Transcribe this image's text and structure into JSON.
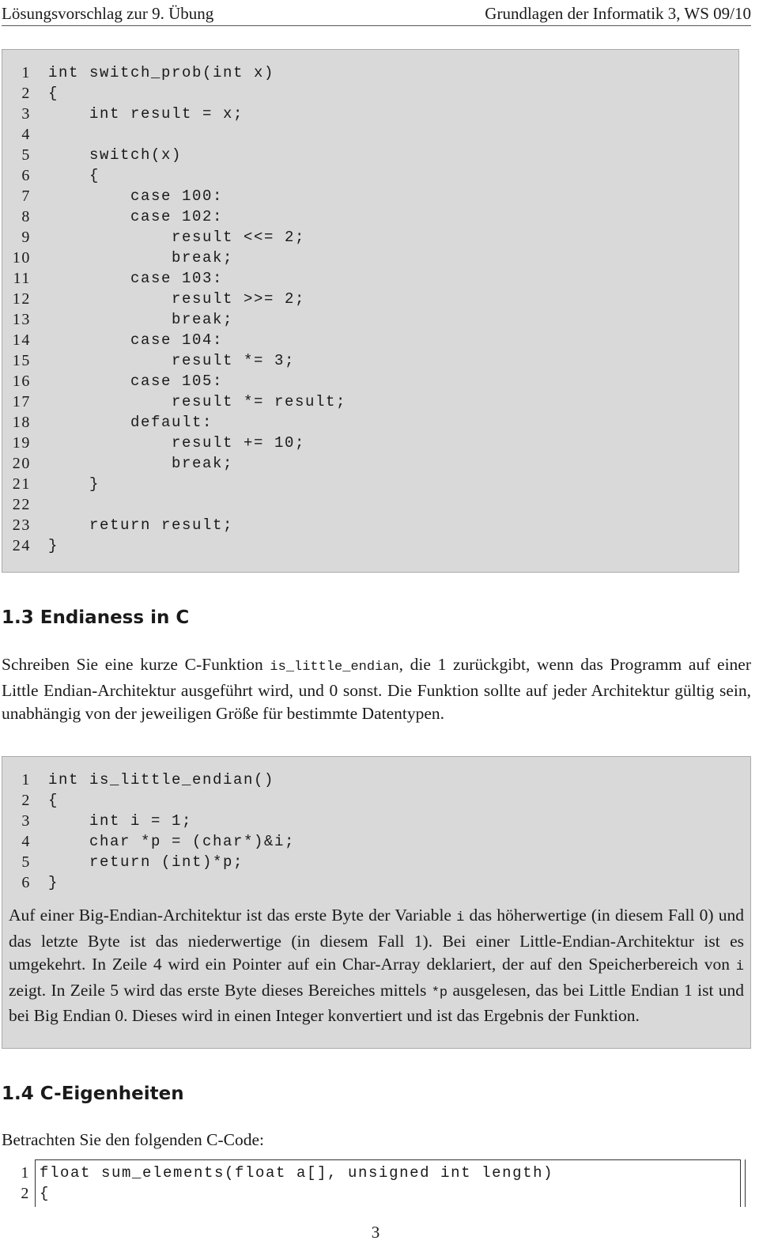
{
  "header": {
    "left": "Lösungsvorschlag zur 9. Übung",
    "right": "Grundlagen der Informatik 3, WS 09/10"
  },
  "code1": [
    {
      "n": "1",
      "t": "int switch_prob(int x)"
    },
    {
      "n": "2",
      "t": "{"
    },
    {
      "n": "3",
      "t": "    int result = x;"
    },
    {
      "n": "4",
      "t": ""
    },
    {
      "n": "5",
      "t": "    switch(x)"
    },
    {
      "n": "6",
      "t": "    {"
    },
    {
      "n": "7",
      "t": "        case 100:"
    },
    {
      "n": "8",
      "t": "        case 102:"
    },
    {
      "n": "9",
      "t": "            result <<= 2;"
    },
    {
      "n": "10",
      "t": "            break;"
    },
    {
      "n": "11",
      "t": "        case 103:"
    },
    {
      "n": "12",
      "t": "            result >>= 2;"
    },
    {
      "n": "13",
      "t": "            break;"
    },
    {
      "n": "14",
      "t": "        case 104:"
    },
    {
      "n": "15",
      "t": "            result *= 3;"
    },
    {
      "n": "16",
      "t": "        case 105:"
    },
    {
      "n": "17",
      "t": "            result *= result;"
    },
    {
      "n": "18",
      "t": "        default:"
    },
    {
      "n": "19",
      "t": "            result += 10;"
    },
    {
      "n": "20",
      "t": "            break;"
    },
    {
      "n": "21",
      "t": "    }"
    },
    {
      "n": "22",
      "t": ""
    },
    {
      "n": "23",
      "t": "    return result;"
    },
    {
      "n": "24",
      "t": "}"
    }
  ],
  "section13": {
    "title": "1.3  Endianess in C",
    "para_a": "Schreiben Sie eine kurze C-Funktion ",
    "para_code": "is_little_endian",
    "para_b": ", die 1 zurückgibt, wenn das Programm auf einer Little Endian-Architektur ausgeführt wird, und 0 sonst. Die Funktion sollte auf jeder Architektur gültig sein, unabhängig von der jeweiligen Größe für bestimmte Datentypen."
  },
  "code2": [
    {
      "n": "1",
      "t": "int is_little_endian()"
    },
    {
      "n": "2",
      "t": "{"
    },
    {
      "n": "3",
      "t": "    int i = 1;"
    },
    {
      "n": "4",
      "t": "    char *p = (char*)&i;"
    },
    {
      "n": "5",
      "t": "    return (int)*p;"
    },
    {
      "n": "6",
      "t": "}"
    }
  ],
  "answer": {
    "p1": "Auf einer Big-Endian-Architektur ist das erste Byte der Variable ",
    "c1": "i",
    "p2": " das höherwertige (in diesem Fall 0) und das letzte Byte ist das niederwertige (in diesem Fall 1). Bei einer Little-Endian-Architektur ist es umgekehrt. In Zeile 4 wird ein Pointer auf ein Char-Array deklariert, der auf den Speicherbereich von ",
    "c2": "i",
    "p3": " zeigt. In Zeile 5 wird das erste Byte dieses Bereiches mittels ",
    "c3": "*p",
    "p4": " ausgelesen, das bei Little Endian 1 ist und bei Big Endian 0. Dieses wird in einen Integer konvertiert und ist das Ergebnis der Funktion."
  },
  "section14": {
    "title": "1.4  C-Eigenheiten",
    "intro": "Betrachten Sie den folgenden C-Code:"
  },
  "code3": [
    {
      "n": "1",
      "t": "float sum_elements(float a[], unsigned int length)"
    },
    {
      "n": "2",
      "t": "{"
    }
  ],
  "page_number": "3"
}
